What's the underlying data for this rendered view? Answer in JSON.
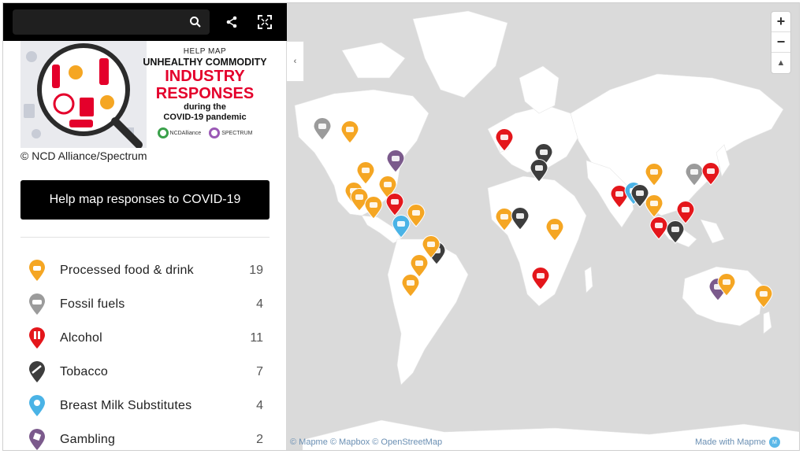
{
  "map": {
    "zoom_in": "+",
    "zoom_out": "−",
    "compass": "▲",
    "attribution": "© Mapme © Mapbox © OpenStreetMap",
    "made_with": "Made with Mapme",
    "badge": "M"
  },
  "banner": {
    "help_map": "HELP MAP",
    "unhealthy": "UNHEALTHY COMMODITY",
    "industry": "INDUSTRY",
    "responses": "RESPONSES",
    "during": "during the",
    "covid": "COVID-19 pandemic",
    "logo1": "NCDAlliance",
    "logo2": "SPECTRUM"
  },
  "panel": {
    "credit": "© NCD Alliance/Spectrum",
    "cta": "Help map responses to COVID-19",
    "collapse": "‹"
  },
  "colors": {
    "processed": "#f5a623",
    "fossil": "#9b9b9b",
    "alcohol": "#e4161b",
    "tobacco": "#3d3d3d",
    "bms": "#4ab3e6",
    "gambling": "#7b5a8c"
  },
  "legend": [
    {
      "label": "Processed food & drink",
      "count": "19",
      "icon": "food-icon"
    },
    {
      "label": "Fossil fuels",
      "count": "4",
      "icon": "car-icon"
    },
    {
      "label": "Alcohol",
      "count": "11",
      "icon": "bottle-icon"
    },
    {
      "label": "Tobacco",
      "count": "7",
      "icon": "cigarette-icon"
    },
    {
      "label": "Breast Milk Substitutes",
      "count": "4",
      "icon": "baby-icon"
    },
    {
      "label": "Gambling",
      "count": "2",
      "icon": "dice-icon"
    }
  ]
}
